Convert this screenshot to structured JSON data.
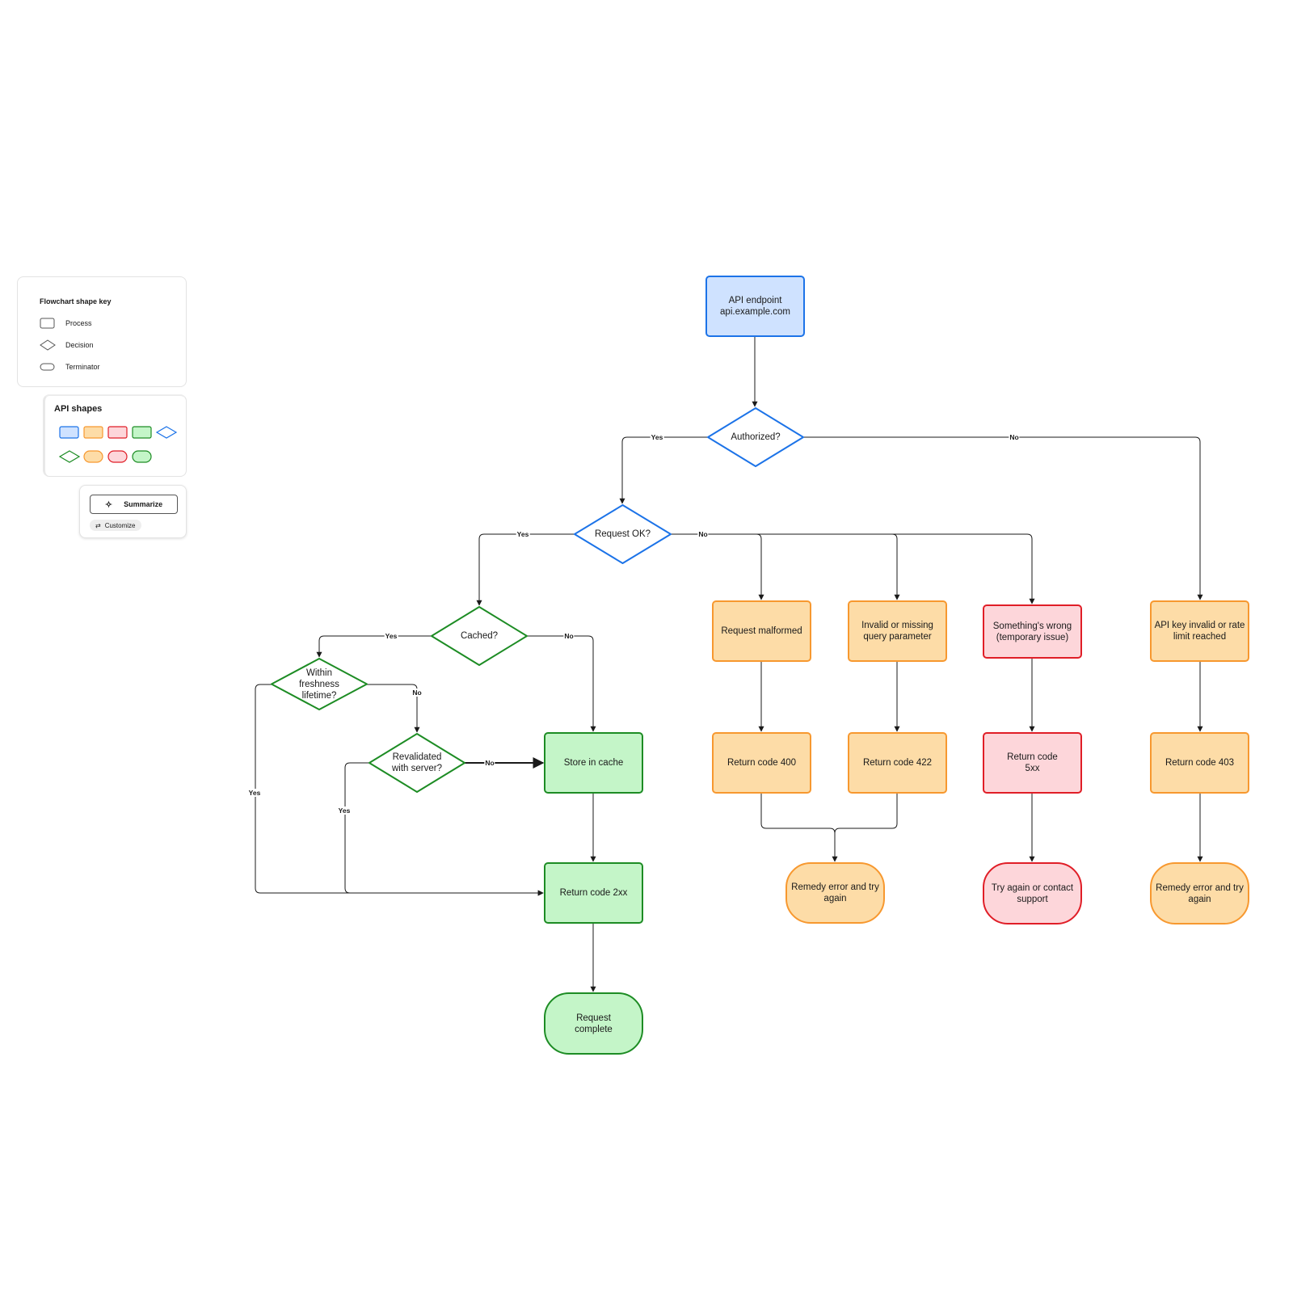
{
  "colors": {
    "blue_fill": "#cfe2ff",
    "blue_stroke": "#1c73e8",
    "orange_fill": "#fddca7",
    "orange_stroke": "#f7982f",
    "red_fill": "#fdd6da",
    "red_stroke": "#e01e27",
    "green_fill": "#c4f5c8",
    "green_stroke": "#1d8c24",
    "edge": "#1a1a1a"
  },
  "shape_key": {
    "title": "Flowchart shape key",
    "items": [
      {
        "shape": "process",
        "label": "Process"
      },
      {
        "shape": "decision",
        "label": "Decision"
      },
      {
        "shape": "terminator",
        "label": "Terminator"
      }
    ]
  },
  "api_shapes": {
    "title": "API shapes",
    "swatches": [
      {
        "shape": "process",
        "color": "blue"
      },
      {
        "shape": "process",
        "color": "orange"
      },
      {
        "shape": "process",
        "color": "red"
      },
      {
        "shape": "process",
        "color": "green"
      },
      {
        "shape": "decision",
        "color": "blue"
      },
      {
        "shape": "decision",
        "color": "green"
      },
      {
        "shape": "terminator",
        "color": "orange"
      },
      {
        "shape": "terminator",
        "color": "red"
      },
      {
        "shape": "terminator",
        "color": "green"
      }
    ]
  },
  "ai_panel": {
    "summarize_label": "Summarize",
    "summarize_icon": "sparkle-icon",
    "customize_label": "Customize",
    "customize_icon": "sliders-icon"
  },
  "nodes": {
    "api_endpoint": {
      "type": "process",
      "color": "blue",
      "label": "API endpoint\napi.example.com"
    },
    "authorized": {
      "type": "decision",
      "color": "blue",
      "label": "Authorized?"
    },
    "request_ok": {
      "type": "decision",
      "color": "blue",
      "label": "Request OK?"
    },
    "cached": {
      "type": "decision",
      "color": "green",
      "label": "Cached?"
    },
    "freshness": {
      "type": "decision",
      "color": "green",
      "label": "Within\nfreshness\nlifetime?"
    },
    "revalidated": {
      "type": "decision",
      "color": "green",
      "label": "Revalidated\nwith server?"
    },
    "store_cache": {
      "type": "process",
      "color": "green",
      "label": "Store in cache"
    },
    "return_2xx": {
      "type": "process",
      "color": "green",
      "label": "Return code 2xx"
    },
    "request_complete": {
      "type": "terminator",
      "color": "green",
      "label": "Request\ncomplete"
    },
    "malformed": {
      "type": "process",
      "color": "orange",
      "label": "Request malformed"
    },
    "invalid_param": {
      "type": "process",
      "color": "orange",
      "label": "Invalid or missing\nquery parameter"
    },
    "something_wrong": {
      "type": "process",
      "color": "red",
      "label": "Something's wrong\n(temporary issue)"
    },
    "api_key_invalid": {
      "type": "process",
      "color": "orange",
      "label": "API key invalid or rate\nlimit reached"
    },
    "return_400": {
      "type": "process",
      "color": "orange",
      "label": "Return code 400"
    },
    "return_422": {
      "type": "process",
      "color": "orange",
      "label": "Return code 422"
    },
    "return_5xx": {
      "type": "process",
      "color": "red",
      "label": "Return code\n5xx"
    },
    "return_403": {
      "type": "process",
      "color": "orange",
      "label": "Return code 403"
    },
    "remedy_1": {
      "type": "terminator",
      "color": "orange",
      "label": "Remedy error and try\nagain"
    },
    "try_again": {
      "type": "terminator",
      "color": "red",
      "label": "Try again or contact\nsupport"
    },
    "remedy_2": {
      "type": "terminator",
      "color": "orange",
      "label": "Remedy error and try\nagain"
    }
  },
  "edges": [
    {
      "from": "api_endpoint",
      "to": "authorized",
      "label": ""
    },
    {
      "from": "authorized",
      "to": "request_ok",
      "label": "Yes"
    },
    {
      "from": "authorized",
      "to": "api_key_invalid",
      "label": "No"
    },
    {
      "from": "request_ok",
      "to": "cached",
      "label": "Yes"
    },
    {
      "from": "request_ok",
      "to": "malformed",
      "label": "No"
    },
    {
      "from": "request_ok",
      "to": "invalid_param",
      "label": ""
    },
    {
      "from": "request_ok",
      "to": "something_wrong",
      "label": ""
    },
    {
      "from": "cached",
      "to": "freshness",
      "label": "Yes"
    },
    {
      "from": "cached",
      "to": "store_cache",
      "label": "No"
    },
    {
      "from": "freshness",
      "to": "revalidated",
      "label": "No"
    },
    {
      "from": "freshness",
      "to": "return_2xx",
      "label": "Yes"
    },
    {
      "from": "revalidated",
      "to": "store_cache",
      "label": "No"
    },
    {
      "from": "revalidated",
      "to": "return_2xx",
      "label": "Yes"
    },
    {
      "from": "store_cache",
      "to": "return_2xx",
      "label": ""
    },
    {
      "from": "return_2xx",
      "to": "request_complete",
      "label": ""
    },
    {
      "from": "malformed",
      "to": "return_400",
      "label": ""
    },
    {
      "from": "invalid_param",
      "to": "return_422",
      "label": ""
    },
    {
      "from": "something_wrong",
      "to": "return_5xx",
      "label": ""
    },
    {
      "from": "api_key_invalid",
      "to": "return_403",
      "label": ""
    },
    {
      "from": "return_400",
      "to": "remedy_1",
      "label": ""
    },
    {
      "from": "return_422",
      "to": "remedy_1",
      "label": ""
    },
    {
      "from": "return_5xx",
      "to": "try_again",
      "label": ""
    },
    {
      "from": "return_403",
      "to": "remedy_2",
      "label": ""
    }
  ]
}
